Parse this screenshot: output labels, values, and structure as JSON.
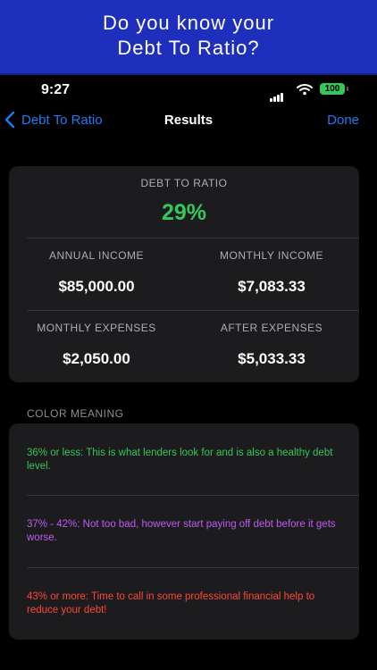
{
  "banner": {
    "line1": "Do you know your",
    "line2": "Debt To Ratio?"
  },
  "status_bar": {
    "time": "9:27",
    "battery": "100"
  },
  "nav": {
    "back_label": "Debt To Ratio",
    "title": "Results",
    "done_label": "Done"
  },
  "summary": {
    "ratio_label": "DEBT TO RATIO",
    "ratio_value": "29%",
    "annual_income_label": "ANNUAL INCOME",
    "annual_income_value": "$85,000.00",
    "monthly_income_label": "MONTHLY INCOME",
    "monthly_income_value": "$7,083.33",
    "monthly_expenses_label": "MONTHLY EXPENSES",
    "monthly_expenses_value": "$2,050.00",
    "after_expenses_label": "AFTER EXPENSES",
    "after_expenses_value": "$5,033.33"
  },
  "color_meaning": {
    "header": "COLOR MEANING",
    "items": [
      {
        "text": "36% or less: This is what lenders look for and is also a healthy debt level.",
        "color": "#34c759"
      },
      {
        "text": "37% - 42%: Not too bad, however start paying off debt before it gets worse.",
        "color": "#bf5af2"
      },
      {
        "text": "43% or more: Time to call in some professional financial help to reduce your debt!",
        "color": "#ff453a"
      }
    ]
  },
  "colors": {
    "accent": "#1e7bf5",
    "banner": "#1e2fbe",
    "good": "#34c759"
  }
}
